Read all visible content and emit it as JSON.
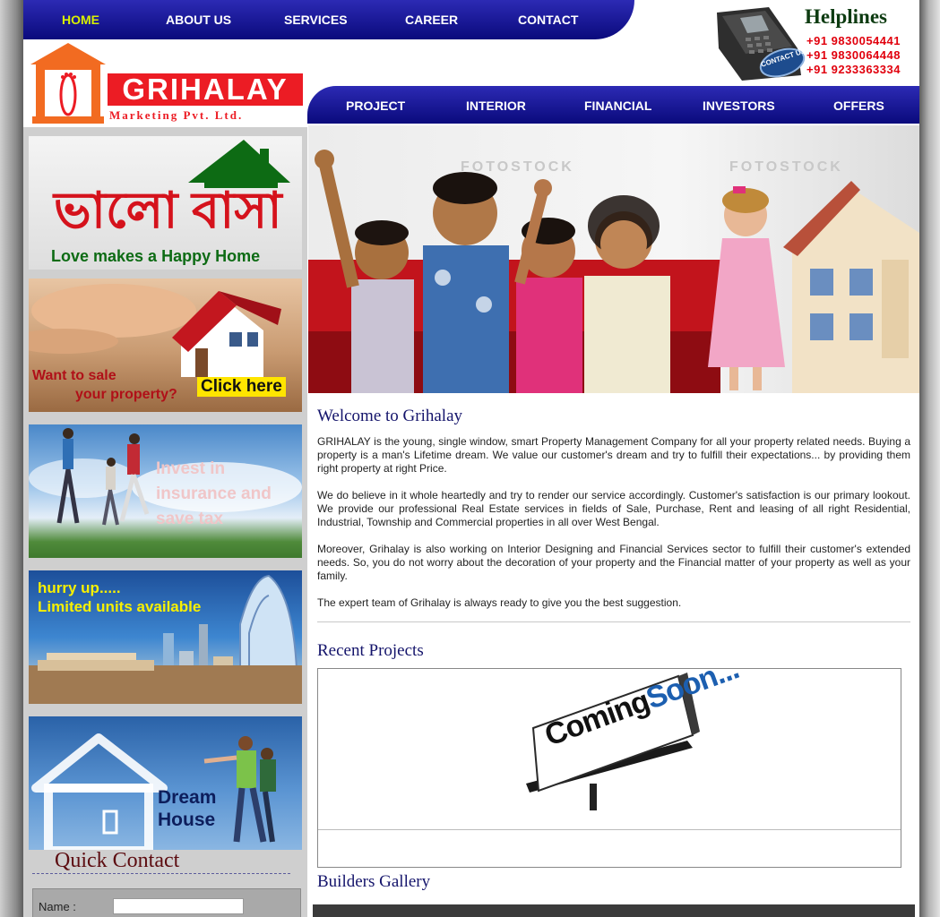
{
  "top_nav": [
    "HOME",
    "ABOUT US",
    "SERVICES",
    "CAREER",
    "CONTACT"
  ],
  "active_nav": "HOME",
  "helplines": {
    "title": "Helplines",
    "numbers": [
      "+91 9830054441",
      "+91 9830064448",
      "+91 9233363334"
    ],
    "phone_badge": "CONTACT US"
  },
  "logo": {
    "name": "GRIHALAY",
    "sub": "Marketing Pvt. Ltd."
  },
  "sub_nav": [
    "PROJECT",
    "INTERIOR",
    "FINANCIAL",
    "INVESTORS",
    "OFFERS"
  ],
  "sidebar": {
    "banner1": {
      "bengali": "ভালো বাসা",
      "tagline": "Love makes a Happy Home"
    },
    "banner2": {
      "line1": "Want to sale",
      "line2": "your property?",
      "cta": "Click here"
    },
    "banner3": {
      "line1": "Invest in",
      "line2": "insurance and",
      "line3": "save tax"
    },
    "banner4": {
      "line1": "hurry up.....",
      "line2": "Limited units available"
    },
    "banner5": {
      "line1": "Dream",
      "line2": "House"
    },
    "quick_contact": {
      "title": "Quick Contact",
      "name_label": "Name :",
      "name_value": ""
    }
  },
  "hero": {
    "watermark": "FOTOSTOCK"
  },
  "welcome": {
    "title": "Welcome to Grihalay",
    "paragraphs": [
      "GRIHALAY is the young, single window, smart Property Management Company for all your property related needs. Buying a property is a man's Lifetime dream. We value our customer's dream and try to fulfill their expectations... by providing them right property at right Price.",
      "We do believe in it whole heartedly and try to render our service accordingly. Customer's satisfaction is our primary lookout. We provide our professional Real Estate services in fields of Sale, Purchase, Rent and leasing of all right Residential, Industrial, Township and Commercial properties in all over West Bengal.",
      "Moreover, Grihalay is also working on Interior Designing and Financial Services sector to fulfill their customer's extended needs. So, you do not worry about the decoration of your property and the Financial matter of your property as well as your family.",
      "The expert team of Grihalay is always ready to give you the best suggestion."
    ]
  },
  "recent_projects": {
    "title": "Recent Projects",
    "billboard_coming": "Coming",
    "billboard_soon": "Soon..."
  },
  "builders_gallery": {
    "title": "Builders Gallery"
  },
  "colors": {
    "nav_blue": "#0a0a7c",
    "active": "#d8f000",
    "brand_red": "#ec1c24",
    "helpline_red": "#e1000d",
    "heading_blue": "#14146b"
  }
}
